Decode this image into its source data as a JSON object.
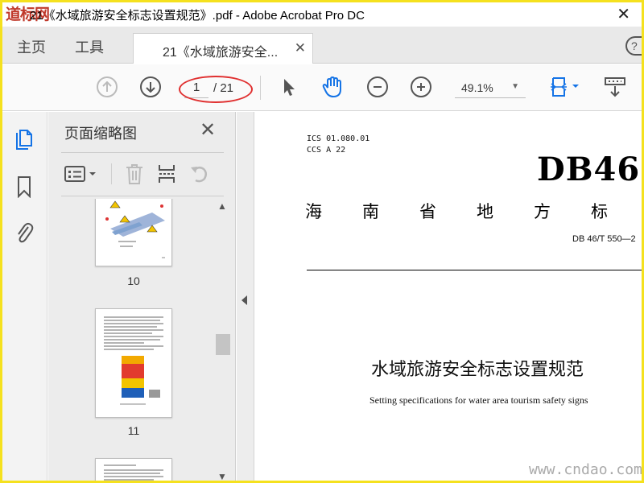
{
  "window": {
    "logo_text": "道标网",
    "title": "21《水域旅游安全标志设置规范》.pdf - Adobe Acrobat Pro DC",
    "close_glyph": "✕"
  },
  "tabs": {
    "home_label": "主页",
    "tools_label": "工具",
    "doc_tab_label": "21《水域旅游安全...",
    "doc_tab_close": "✕",
    "help_glyph": "?"
  },
  "toolbar": {
    "current_page": "1",
    "page_total": "/ 21",
    "zoom_value": "49.1%",
    "highlight_color": "#e03030"
  },
  "thumbnail_panel": {
    "title": "页面缩略图",
    "close_glyph": "✕",
    "thumbnails": [
      {
        "label": "10"
      },
      {
        "label": "11"
      },
      {
        "label": ""
      }
    ]
  },
  "document": {
    "ics": "ICS  01.080.01",
    "ccs": "CCS  A 22",
    "db_heading": "DB46",
    "region_chars": [
      "海",
      "南",
      "省",
      "地",
      "方",
      "标"
    ],
    "standard_code": "DB 46/T 550—2",
    "cn_title": "水域旅游安全标志设置规范",
    "en_title": "Setting specifications for water area tourism safety signs"
  },
  "watermark": {
    "text": "www.cndao.com"
  },
  "colors": {
    "frame": "#f5e11e",
    "accent_blue": "#1473e6"
  }
}
